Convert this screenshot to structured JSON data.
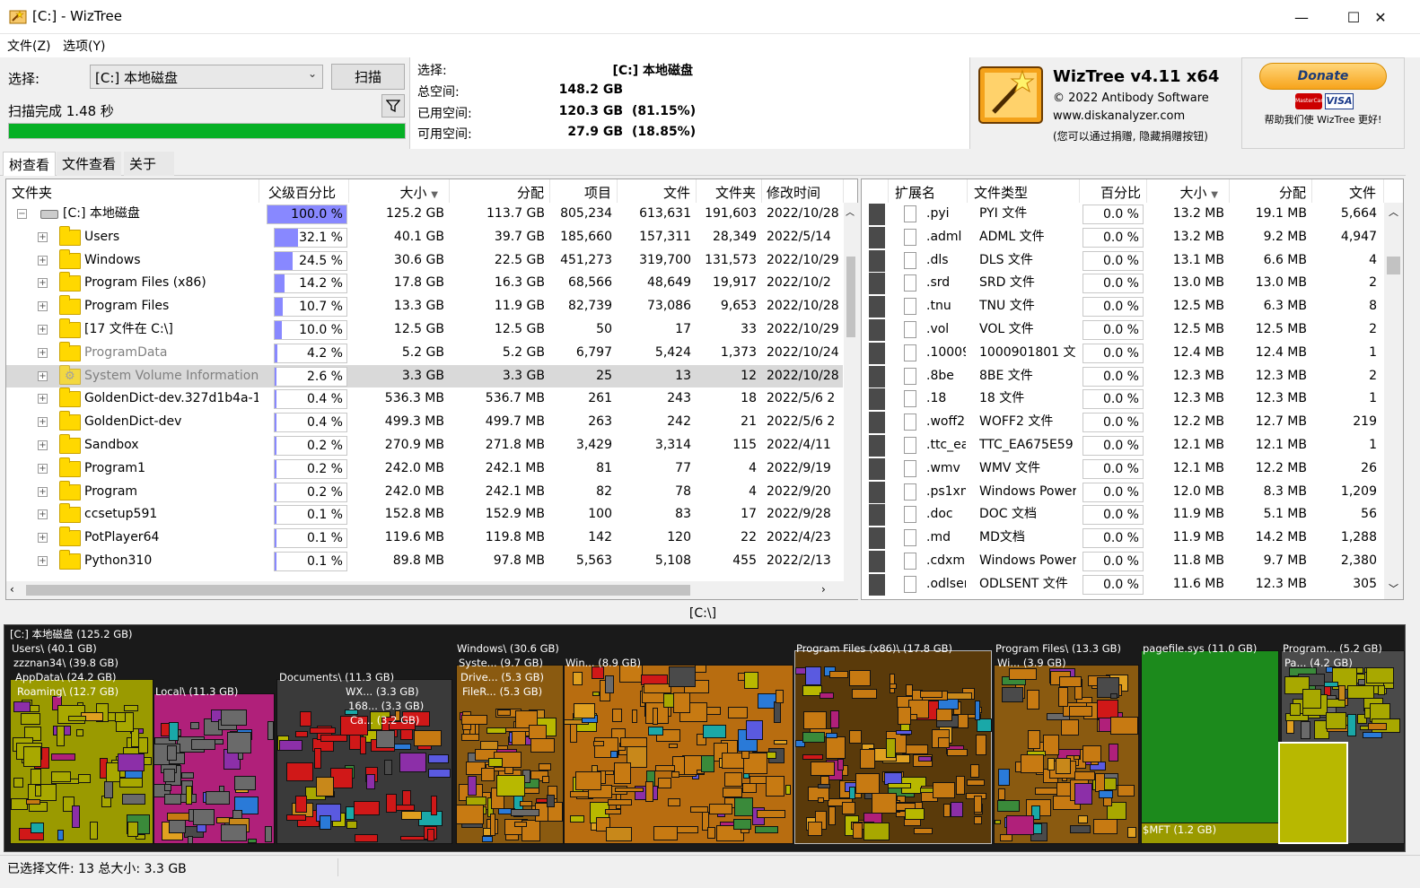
{
  "window": {
    "title": "[C:]  - WizTree",
    "controls": [
      "minimize-icon",
      "maximize-icon",
      "close-icon"
    ]
  },
  "menu": [
    {
      "label": "文件(Z)"
    },
    {
      "label": "选项(Y)"
    }
  ],
  "scan": {
    "select_label": "选择:",
    "drive_value": "[C:] 本地磁盘",
    "scan_button": "扫描",
    "status": "扫描完成 1.48 秒",
    "progress": 1.0
  },
  "info": {
    "select_label": "选择:",
    "select_value": "[C:]  本地磁盘",
    "total_label": "总空间:",
    "total_value": "148.2 GB",
    "used_label": "已用空间:",
    "used_value": "120.3 GB",
    "used_pct": "(81.15%)",
    "free_label": "可用空间:",
    "free_value": "27.9 GB",
    "free_pct": "(18.85%)"
  },
  "about": {
    "name": "WizTree v4.11 x64",
    "copyright": "© 2022 Antibody Software",
    "website": "www.diskanalyzer.com",
    "note": "(您可以通过捐赠, 隐藏捐赠按钮)"
  },
  "donate": {
    "button": "Donate",
    "caption": "帮助我们使 WizTree 更好!",
    "cards": [
      "MasterCard",
      "VISA"
    ]
  },
  "tabs": [
    {
      "label": "树查看",
      "active": true
    },
    {
      "label": "文件查看"
    },
    {
      "label": "关于"
    }
  ],
  "tree": {
    "columns": [
      "文件夹",
      "父级百分比",
      "大小",
      "分配",
      "项目",
      "文件",
      "文件夹",
      "修改时间"
    ],
    "rows": [
      {
        "name": "[C:] 本地磁盘",
        "pct": "100.0 %",
        "pct_fill": 1.0,
        "size": "125.2 GB",
        "alloc": "113.7 GB",
        "items": "805,234",
        "files": "613,631",
        "folders": "191,603",
        "date": "2022/10/28",
        "type": "drive"
      },
      {
        "name": "Users",
        "pct": "32.1 %",
        "pct_fill": 0.321,
        "size": "40.1 GB",
        "alloc": "39.7 GB",
        "items": "185,660",
        "files": "157,311",
        "folders": "28,349",
        "date": "2022/5/14"
      },
      {
        "name": "Windows",
        "pct": "24.5 %",
        "pct_fill": 0.245,
        "size": "30.6 GB",
        "alloc": "22.5 GB",
        "items": "451,273",
        "files": "319,700",
        "folders": "131,573",
        "date": "2022/10/29"
      },
      {
        "name": "Program Files (x86)",
        "pct": "14.2 %",
        "pct_fill": 0.142,
        "size": "17.8 GB",
        "alloc": "16.3 GB",
        "items": "68,566",
        "files": "48,649",
        "folders": "19,917",
        "date": "2022/10/2"
      },
      {
        "name": "Program Files",
        "pct": "10.7 %",
        "pct_fill": 0.107,
        "size": "13.3 GB",
        "alloc": "11.9 GB",
        "items": "82,739",
        "files": "73,086",
        "folders": "9,653",
        "date": "2022/10/28"
      },
      {
        "name": "[17 文件在 C:\\]",
        "pct": "10.0 %",
        "pct_fill": 0.1,
        "size": "12.5 GB",
        "alloc": "12.5 GB",
        "items": "50",
        "files": "17",
        "folders": "33",
        "date": "2022/10/29"
      },
      {
        "name": "ProgramData",
        "pct": "4.2 %",
        "pct_fill": 0.042,
        "size": "5.2 GB",
        "alloc": "5.2 GB",
        "items": "6,797",
        "files": "5,424",
        "folders": "1,373",
        "date": "2022/10/24",
        "dim": true
      },
      {
        "name": "System Volume Information",
        "pct": "2.6 %",
        "pct_fill": 0.026,
        "size": "3.3 GB",
        "alloc": "3.3 GB",
        "items": "25",
        "files": "13",
        "folders": "12",
        "date": "2022/10/28",
        "dim": true,
        "selected": true,
        "type": "system"
      },
      {
        "name": "GoldenDict-dev.327d1b4a-1",
        "pct": "0.4 %",
        "pct_fill": 0.004,
        "size": "536.3 MB",
        "alloc": "536.7 MB",
        "items": "261",
        "files": "243",
        "folders": "18",
        "date": "2022/5/6 2"
      },
      {
        "name": "GoldenDict-dev",
        "pct": "0.4 %",
        "pct_fill": 0.004,
        "size": "499.3 MB",
        "alloc": "499.7 MB",
        "items": "263",
        "files": "242",
        "folders": "21",
        "date": "2022/5/6 2"
      },
      {
        "name": "Sandbox",
        "pct": "0.2 %",
        "pct_fill": 0.002,
        "size": "270.9 MB",
        "alloc": "271.8 MB",
        "items": "3,429",
        "files": "3,314",
        "folders": "115",
        "date": "2022/4/11"
      },
      {
        "name": "Program1",
        "pct": "0.2 %",
        "pct_fill": 0.002,
        "size": "242.0 MB",
        "alloc": "242.1 MB",
        "items": "81",
        "files": "77",
        "folders": "4",
        "date": "2022/9/19"
      },
      {
        "name": "Program",
        "pct": "0.2 %",
        "pct_fill": 0.002,
        "size": "242.0 MB",
        "alloc": "242.1 MB",
        "items": "82",
        "files": "78",
        "folders": "4",
        "date": "2022/9/20"
      },
      {
        "name": "ccsetup591",
        "pct": "0.1 %",
        "pct_fill": 0.001,
        "size": "152.8 MB",
        "alloc": "152.9 MB",
        "items": "100",
        "files": "83",
        "folders": "17",
        "date": "2022/9/28"
      },
      {
        "name": "PotPlayer64",
        "pct": "0.1 %",
        "pct_fill": 0.001,
        "size": "119.6 MB",
        "alloc": "119.8 MB",
        "items": "142",
        "files": "120",
        "folders": "22",
        "date": "2022/4/23"
      },
      {
        "name": "Python310",
        "pct": "0.1 %",
        "pct_fill": 0.001,
        "size": "89.8 MB",
        "alloc": "97.8 MB",
        "items": "5,563",
        "files": "5,108",
        "folders": "455",
        "date": "2022/2/13"
      }
    ]
  },
  "ext": {
    "columns": [
      "扩展名",
      "文件类型",
      "百分比",
      "大小",
      "分配",
      "文件"
    ],
    "rows": [
      {
        "ext": ".pyi",
        "type": "PYI 文件",
        "pct": "0.0 %",
        "size": "13.2 MB",
        "alloc": "19.1 MB",
        "files": "5,664"
      },
      {
        "ext": ".adml",
        "type": "ADML 文件",
        "pct": "0.0 %",
        "size": "13.2 MB",
        "alloc": "9.2 MB",
        "files": "4,947"
      },
      {
        "ext": ".dls",
        "type": "DLS 文件",
        "pct": "0.0 %",
        "size": "13.1 MB",
        "alloc": "6.6 MB",
        "files": "4"
      },
      {
        "ext": ".srd",
        "type": "SRD 文件",
        "pct": "0.0 %",
        "size": "13.0 MB",
        "alloc": "13.0 MB",
        "files": "2"
      },
      {
        "ext": ".tnu",
        "type": "TNU 文件",
        "pct": "0.0 %",
        "size": "12.5 MB",
        "alloc": "6.3 MB",
        "files": "8"
      },
      {
        "ext": ".vol",
        "type": "VOL 文件",
        "pct": "0.0 %",
        "size": "12.5 MB",
        "alloc": "12.5 MB",
        "files": "2"
      },
      {
        "ext": ".10009",
        "type": "1000901801 文件",
        "pct": "0.0 %",
        "size": "12.4 MB",
        "alloc": "12.4 MB",
        "files": "1"
      },
      {
        "ext": ".8be",
        "type": "8BE 文件",
        "pct": "0.0 %",
        "size": "12.3 MB",
        "alloc": "12.3 MB",
        "files": "2"
      },
      {
        "ext": ".18",
        "type": "18 文件",
        "pct": "0.0 %",
        "size": "12.3 MB",
        "alloc": "12.3 MB",
        "files": "1"
      },
      {
        "ext": ".woff2",
        "type": "WOFF2 文件",
        "pct": "0.0 %",
        "size": "12.2 MB",
        "alloc": "12.7 MB",
        "files": "219"
      },
      {
        "ext": ".ttc_ea",
        "type": "TTC_EA675E59 文",
        "pct": "0.0 %",
        "size": "12.1 MB",
        "alloc": "12.1 MB",
        "files": "1"
      },
      {
        "ext": ".wmv",
        "type": "WMV 文件",
        "pct": "0.0 %",
        "size": "12.1 MB",
        "alloc": "12.2 MB",
        "files": "26"
      },
      {
        "ext": ".ps1xm",
        "type": "Windows PowerS",
        "pct": "0.0 %",
        "size": "12.0 MB",
        "alloc": "8.3 MB",
        "files": "1,209"
      },
      {
        "ext": ".doc",
        "type": "DOC 文档",
        "pct": "0.0 %",
        "size": "11.9 MB",
        "alloc": "5.1 MB",
        "files": "56"
      },
      {
        "ext": ".md",
        "type": "MD文档",
        "pct": "0.0 %",
        "size": "11.9 MB",
        "alloc": "14.2 MB",
        "files": "1,288"
      },
      {
        "ext": ".cdxml",
        "type": "Windows PowerS",
        "pct": "0.0 %",
        "size": "11.8 MB",
        "alloc": "9.7 MB",
        "files": "2,380"
      },
      {
        "ext": ".odlsent",
        "type": "ODLSENT 文件",
        "pct": "0.0 %",
        "size": "11.6 MB",
        "alloc": "12.3 MB",
        "files": "305"
      }
    ]
  },
  "path": "[C:\\]",
  "treemap": {
    "labels": [
      "[C:] 本地磁盘  (125.2 GB)",
      "Users\\ (40.1 GB)",
      "zzznan34\\ (39.8 GB)",
      "AppData\\ (24.2 GB)",
      "Roaming\\ (12.7 GB)",
      "Local\\ (11.3 GB)",
      "Documents\\ (11.3 GB)",
      "WX... (3.3 GB)",
      "168... (3.3 GB)",
      "Ca... (3.2 GB)",
      "Windows\\ (30.6 GB)",
      "Syste... (9.7 GB)",
      "Drive... (5.3 GB)",
      "FileR... (5.3 GB)",
      "Win... (8.9 GB)",
      "Program Files (x86)\\ (17.8 GB)",
      "Program Files\\ (13.3 GB)",
      "Wi... (3.9 GB)",
      "pagefile.sys (11.0 GB)",
      "$MFT (1.2 GB)",
      "Program... (5.2 GB)",
      "Pa... (4.2 GB)"
    ]
  },
  "status": {
    "text": "已选择文件: 13  总大小: 3.3 GB"
  },
  "colors": {
    "progress": "#06b025",
    "pct_bar": "#8888ff",
    "selected_row": "#d9d9d9",
    "dim_text": "#808080"
  }
}
